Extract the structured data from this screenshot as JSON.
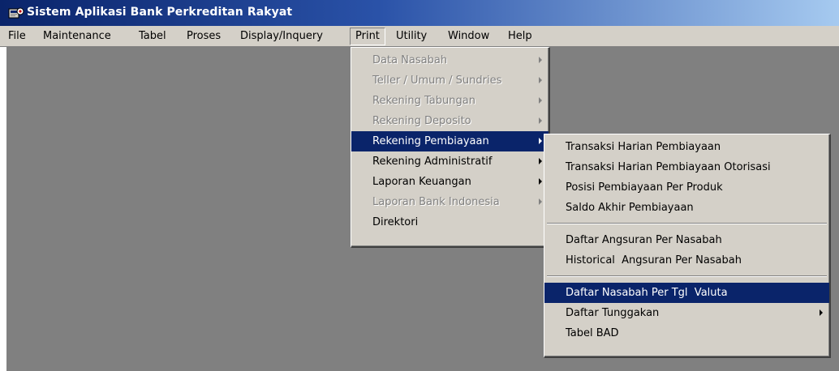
{
  "window": {
    "title": "Sistem Aplikasi Bank Perkreditan Rakyat",
    "app_icon": "application-icon"
  },
  "menubar": {
    "items": [
      {
        "label": "File"
      },
      {
        "label": "Maintenance"
      },
      {
        "label": "Tabel"
      },
      {
        "label": "Proses"
      },
      {
        "label": "Display/Inquery"
      },
      {
        "label": "Print",
        "open": true
      },
      {
        "label": "Utility"
      },
      {
        "label": "Window"
      },
      {
        "label": "Help"
      }
    ]
  },
  "print_menu": {
    "items": [
      {
        "label": "Data Nasabah",
        "enabled": false,
        "submenu": true
      },
      {
        "label": "Teller / Umum / Sundries",
        "enabled": false,
        "submenu": true
      },
      {
        "label": "Rekening Tabungan",
        "enabled": false,
        "submenu": true
      },
      {
        "label": "Rekening Deposito",
        "enabled": false,
        "submenu": true
      },
      {
        "label": "Rekening Pembiayaan",
        "enabled": true,
        "submenu": true,
        "highlighted": true
      },
      {
        "label": "Rekening Administratif",
        "enabled": true,
        "submenu": true
      },
      {
        "label": "Laporan Keuangan",
        "enabled": true,
        "submenu": true
      },
      {
        "label": "Laporan Bank Indonesia",
        "enabled": false,
        "submenu": true
      },
      {
        "label": "Direktori",
        "enabled": true,
        "submenu": false
      }
    ]
  },
  "pembiayaan_submenu": {
    "group1": [
      {
        "label": "Transaksi Harian Pembiayaan"
      },
      {
        "label": "Transaksi Harian Pembiayaan Otorisasi"
      },
      {
        "label": "Posisi Pembiayaan Per Produk"
      },
      {
        "label": "Saldo Akhir Pembiayaan"
      }
    ],
    "group2": [
      {
        "label": "Daftar Angsuran Per Nasabah"
      },
      {
        "label": "Historical  Angsuran Per Nasabah"
      }
    ],
    "group3": [
      {
        "label": "Daftar Nasabah Per Tgl  Valuta",
        "highlighted": true
      },
      {
        "label": "Daftar Tunggakan",
        "submenu": true
      },
      {
        "label": "Tabel BAD"
      }
    ]
  }
}
